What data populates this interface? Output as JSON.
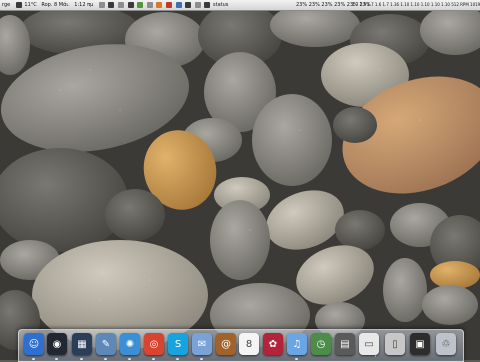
{
  "menubar": {
    "left_items": [
      "rge",
      "11°C",
      "Rop. 8 Μάι.",
      "1:12 πμ"
    ],
    "app_name": "status",
    "cpu_readout": "23% 23% 23% 23% 23% 23%",
    "clock_readout": "1.7 1.9 1.7 1.6 1.7 1.36 1.10 1.10 1.10 1.10 1.10 512 RPM 1019 RPM 1083 RPM 1088 RPM 46"
  },
  "dock": {
    "items": [
      {
        "name": "finder",
        "icon": "finder-icon",
        "glyph": "☺",
        "color": "#2f6fd0"
      },
      {
        "name": "dashboard",
        "icon": "dashboard-icon",
        "glyph": "◉",
        "color": "#222831"
      },
      {
        "name": "mission-control",
        "icon": "mission-control-icon",
        "glyph": "▦",
        "color": "#2a3e57"
      },
      {
        "name": "preview",
        "icon": "preview-icon",
        "glyph": "✎",
        "color": "#5d88b8"
      },
      {
        "name": "safari",
        "icon": "safari-icon",
        "glyph": "✺",
        "color": "#3a8fd6"
      },
      {
        "name": "chrome",
        "icon": "chrome-icon",
        "glyph": "◎",
        "color": "#d8442f"
      },
      {
        "name": "skype",
        "icon": "skype-icon",
        "glyph": "S",
        "color": "#17a3e0"
      },
      {
        "name": "mail",
        "icon": "mail-icon",
        "glyph": "✉",
        "color": "#7ba2d6"
      },
      {
        "name": "address-book",
        "icon": "address-book-icon",
        "glyph": "@",
        "color": "#a2622c"
      },
      {
        "name": "ical",
        "icon": "calendar-icon",
        "glyph": "8",
        "color": "#f4f4f4"
      },
      {
        "name": "photo-booth",
        "icon": "photo-booth-icon",
        "glyph": "✿",
        "color": "#b2243b"
      },
      {
        "name": "itunes",
        "icon": "itunes-icon",
        "glyph": "♫",
        "color": "#6aa6e6"
      },
      {
        "name": "time-machine",
        "icon": "time-machine-icon",
        "glyph": "◷",
        "color": "#4c8d4a"
      },
      {
        "name": "activity-monitor",
        "icon": "activity-monitor-icon",
        "glyph": "▤",
        "color": "#5a5a5a"
      },
      {
        "name": "document",
        "icon": "document-icon",
        "glyph": "▭",
        "color": "#e8e8e8"
      },
      {
        "name": "folder",
        "icon": "folder-icon",
        "glyph": "▯",
        "color": "#c7c7c7"
      },
      {
        "name": "screen",
        "icon": "screen-icon",
        "glyph": "▣",
        "color": "#2d2d2d"
      },
      {
        "name": "trash",
        "icon": "trash-icon",
        "glyph": "♲",
        "color": "#bdc3ca"
      }
    ]
  }
}
